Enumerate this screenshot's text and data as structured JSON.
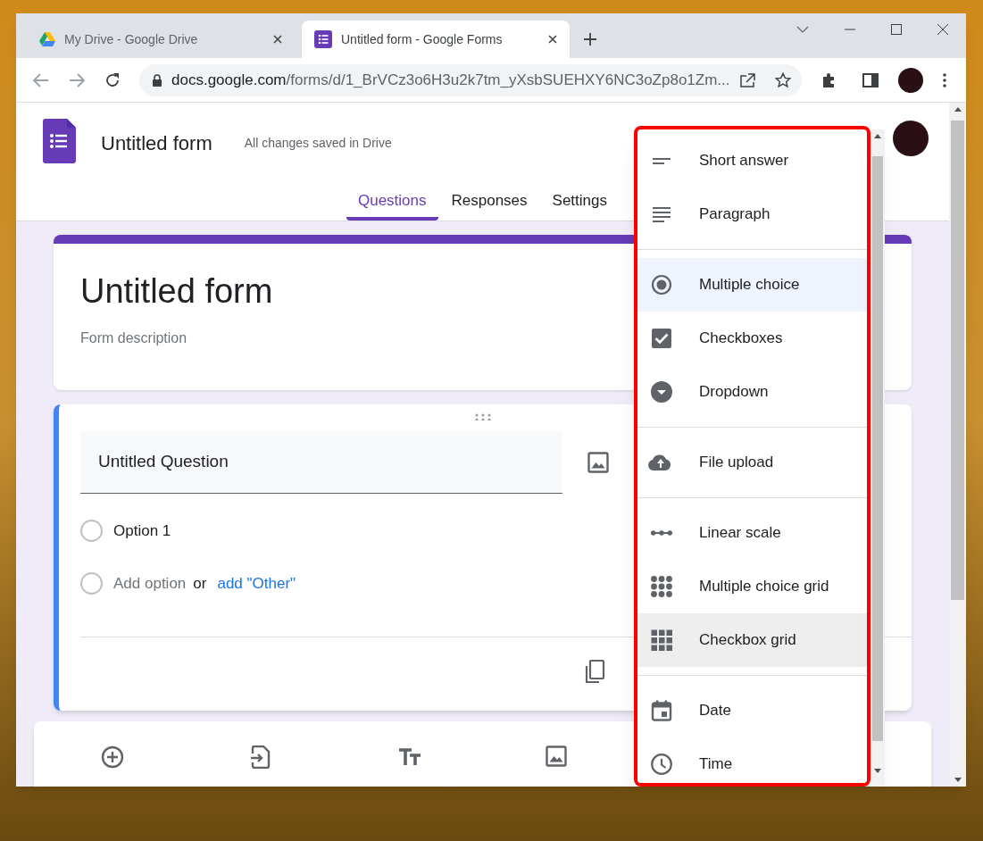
{
  "browser": {
    "tabs": [
      {
        "title": "My Drive - Google Drive",
        "kind": "drive",
        "selected": false
      },
      {
        "title": "Untitled form - Google Forms",
        "kind": "forms",
        "selected": true
      }
    ],
    "address_host": "docs.google.com",
    "address_path": "/forms/d/1_BrVCz3o6H3u2k7tm_yXsbSUEHXY6NC3oZp8o1Zm..."
  },
  "header": {
    "title": "Untitled form",
    "save_status": "All changes saved in Drive",
    "tabs": [
      {
        "label": "Questions",
        "selected": true
      },
      {
        "label": "Responses",
        "selected": false
      },
      {
        "label": "Settings",
        "selected": false
      }
    ]
  },
  "form": {
    "title": "Untitled form",
    "description_placeholder": "Form description"
  },
  "question": {
    "title": "Untitled Question",
    "options": [
      {
        "label": "Option 1",
        "selected": false
      }
    ],
    "add_option": {
      "label": "Add option",
      "selected": false
    },
    "or": "or",
    "add_other": "add \"Other\""
  },
  "menu": {
    "groups": [
      {
        "items": [
          {
            "label": "Short answer",
            "kind": "short",
            "selected": false,
            "hovered": false
          },
          {
            "label": "Paragraph",
            "kind": "paragraph",
            "selected": false,
            "hovered": false
          }
        ]
      },
      {
        "items": [
          {
            "label": "Multiple choice",
            "kind": "radio",
            "selected": true,
            "hovered": false
          },
          {
            "label": "Checkboxes",
            "kind": "checkbox",
            "selected": false,
            "hovered": false
          },
          {
            "label": "Dropdown",
            "kind": "dropdown",
            "selected": false,
            "hovered": false
          }
        ]
      },
      {
        "items": [
          {
            "label": "File upload",
            "kind": "upload",
            "selected": false,
            "hovered": false
          }
        ]
      },
      {
        "items": [
          {
            "label": "Linear scale",
            "kind": "scale",
            "selected": false,
            "hovered": false
          },
          {
            "label": "Multiple choice grid",
            "kind": "radiogrid",
            "selected": false,
            "hovered": false
          },
          {
            "label": "Checkbox grid",
            "kind": "checkgrid",
            "selected": false,
            "hovered": true
          }
        ]
      },
      {
        "items": [
          {
            "label": "Date",
            "kind": "date",
            "selected": false,
            "hovered": false
          },
          {
            "label": "Time",
            "kind": "time",
            "selected": false,
            "hovered": false
          }
        ]
      }
    ]
  }
}
